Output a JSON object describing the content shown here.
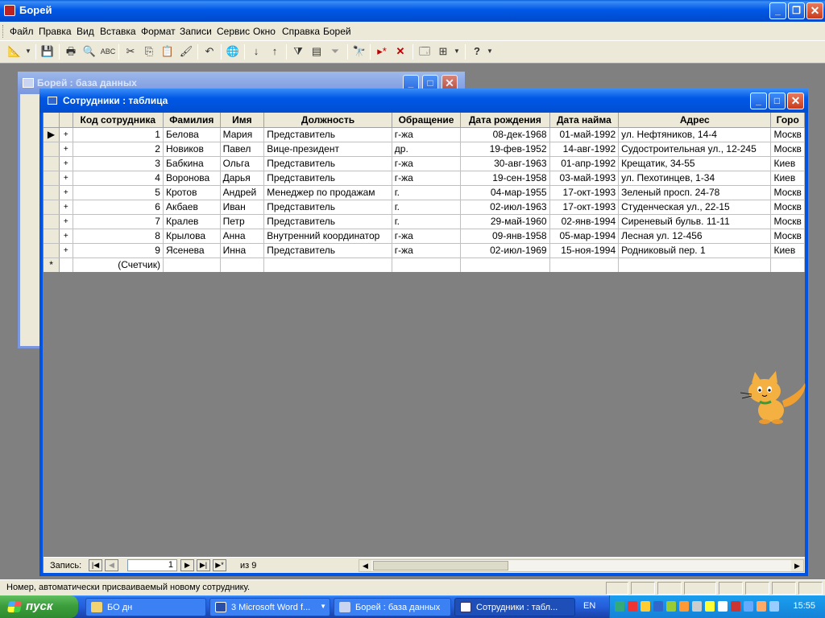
{
  "app": {
    "title": "Борей"
  },
  "menu": [
    "Файл",
    "Правка",
    "Вид",
    "Вставка",
    "Формат",
    "Записи",
    "Сервис",
    "Окно",
    "Справка",
    "Борей"
  ],
  "db_window": {
    "title": "Борей : база данных"
  },
  "table_window": {
    "title": "Сотрудники : таблица"
  },
  "table": {
    "columns": [
      "Код сотрудника",
      "Фамилия",
      "Имя",
      "Должность",
      "Обращение",
      "Дата рождения",
      "Дата найма",
      "Адрес",
      "Горо"
    ],
    "rows": [
      [
        "1",
        "Белова",
        "Мария",
        "Представитель",
        "г-жа",
        "08-дек-1968",
        "01-май-1992",
        "ул. Нефтяников, 14-4",
        "Москв"
      ],
      [
        "2",
        "Новиков",
        "Павел",
        "Вице-президент",
        "др.",
        "19-фев-1952",
        "14-авг-1992",
        "Судостроительная ул., 12-245",
        "Москв"
      ],
      [
        "3",
        "Бабкина",
        "Ольга",
        "Представитель",
        "г-жа",
        "30-авг-1963",
        "01-апр-1992",
        "Крещатик, 34-55",
        "Киев"
      ],
      [
        "4",
        "Воронова",
        "Дарья",
        "Представитель",
        "г-жа",
        "19-сен-1958",
        "03-май-1993",
        "ул. Пехотинцев, 1-34",
        "Киев"
      ],
      [
        "5",
        "Кротов",
        "Андрей",
        "Менеджер по продажам",
        "г.",
        "04-мар-1955",
        "17-окт-1993",
        "Зеленый просп. 24-78",
        "Москв"
      ],
      [
        "6",
        "Акбаев",
        "Иван",
        "Представитель",
        "г.",
        "02-июл-1963",
        "17-окт-1993",
        "Студенческая ул., 22-15",
        "Москв"
      ],
      [
        "7",
        "Кралев",
        "Петр",
        "Представитель",
        "г.",
        "29-май-1960",
        "02-янв-1994",
        "Сиреневый бульв. 11-11",
        "Москв"
      ],
      [
        "8",
        "Крылова",
        "Анна",
        "Внутренний координатор",
        "г-жа",
        "09-янв-1958",
        "05-мар-1994",
        "Лесная ул. 12-456",
        "Москв"
      ],
      [
        "9",
        "Ясенева",
        "Инна",
        "Представитель",
        "г-жа",
        "02-июл-1969",
        "15-ноя-1994",
        "Родниковый пер. 1",
        "Киев"
      ]
    ],
    "new_row_placeholder": "(Счетчик)"
  },
  "navigator": {
    "label": "Запись:",
    "current": "1",
    "of_text": "из  9"
  },
  "status": {
    "text": "Номер, автоматически присваиваемый новому сотруднику."
  },
  "taskbar": {
    "start": "пуск",
    "tasks": [
      "БО дн",
      "3 Microsoft Word f...",
      "Борей : база данных",
      "Сотрудники : табл..."
    ],
    "lang": "EN",
    "clock": "15:55"
  }
}
